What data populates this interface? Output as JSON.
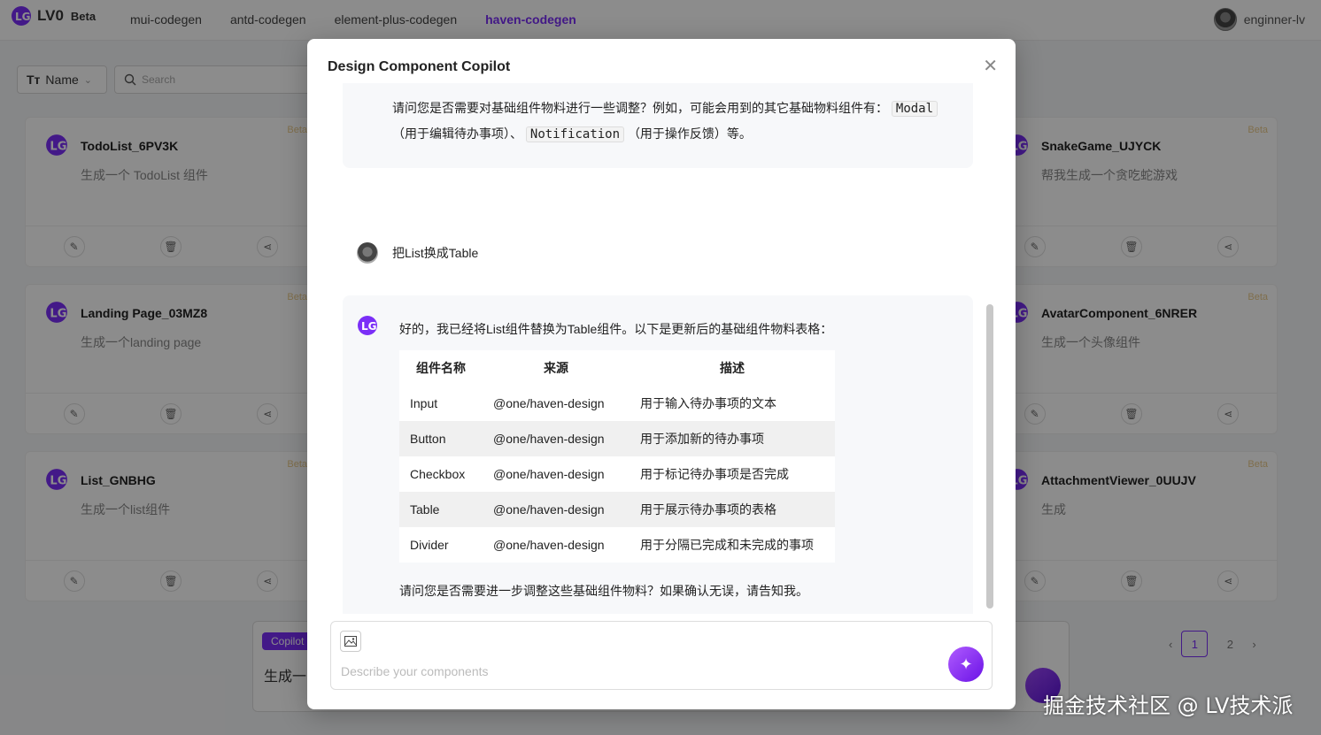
{
  "brand": {
    "name": "LV0",
    "tag": "Beta"
  },
  "nav": [
    "mui-codegen",
    "antd-codegen",
    "element-plus-codegen",
    "haven-codegen"
  ],
  "user": {
    "name": "enginner-lv"
  },
  "filter": {
    "label": "Name",
    "search_placeholder": "Search"
  },
  "cards": [
    {
      "title": "TodoList_6PV3K",
      "desc": "生成一个 TodoList 组件",
      "badge": "Beta"
    },
    {
      "title": "Landing Page_03MZ8",
      "desc": "生成一个landing page",
      "badge": "Beta"
    },
    {
      "title": "List_GNBHG",
      "desc": "生成一个list组件",
      "badge": "Beta"
    },
    {
      "title": "SnakeGame_UJYCK",
      "desc": "帮我生成一个贪吃蛇游戏",
      "badge": "Beta"
    },
    {
      "title": "AvatarComponent_6NRER",
      "desc": "生成一个头像组件",
      "badge": "Beta"
    },
    {
      "title": "AttachmentViewer_0UUJV",
      "desc": "生成",
      "badge": "Beta"
    }
  ],
  "bg_copilot": {
    "tag": "Copilot",
    "text": "生成一"
  },
  "pager": {
    "current": "1",
    "next": "2"
  },
  "watermark": "掘金技术社区 @ LV技术派",
  "modal": {
    "title": "Design Component Copilot",
    "msg1_part1": "请问您是否需要对基础组件物料进行一些调整？例如，可能会用到的其它基础物料组件有：",
    "msg1_code1": "Modal",
    "msg1_part2": "（用于编辑待办事项）、",
    "msg1_code2": "Notification",
    "msg1_part3": "（用于操作反馈）等。",
    "user_msg": "把List换成Table",
    "ai_intro": "好的，我已经将List组件替换为Table组件。以下是更新后的基础组件物料表格：",
    "table_headers": [
      "组件名称",
      "来源",
      "描述"
    ],
    "table_rows": [
      [
        "Input",
        "@one/haven-design",
        "用于输入待办事项的文本"
      ],
      [
        "Button",
        "@one/haven-design",
        "用于添加新的待办事项"
      ],
      [
        "Checkbox",
        "@one/haven-design",
        "用于标记待办事项是否完成"
      ],
      [
        "Table",
        "@one/haven-design",
        "用于展示待办事项的表格"
      ],
      [
        "Divider",
        "@one/haven-design",
        "用于分隔已完成和未完成的事项"
      ]
    ],
    "ai_outro": "请问您是否需要进一步调整这些基础组件物料？如果确认无误，请告知我。",
    "input_placeholder": "Describe your components"
  },
  "colors": {
    "accent": "#7b2ff7",
    "badge": "#e8c98a"
  }
}
